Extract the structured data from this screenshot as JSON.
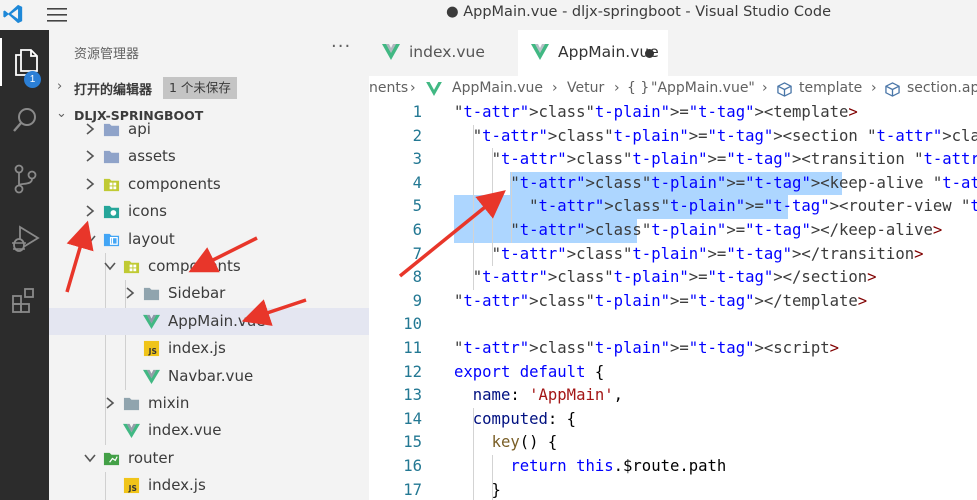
{
  "window": {
    "title": "● AppMain.vue - dljx-springboot - Visual Studio Code"
  },
  "activity_bar": {
    "items": [
      {
        "icon": "files-icon",
        "active": true,
        "badge": "1"
      },
      {
        "icon": "search-icon"
      },
      {
        "icon": "source-control-icon"
      },
      {
        "icon": "run-debug-icon"
      },
      {
        "icon": "extensions-icon"
      }
    ]
  },
  "sidebar": {
    "title": "资源管理器",
    "more": "···",
    "open_editors": {
      "label": "打开的编辑器",
      "unsaved": "1 个未保存"
    },
    "project": "DLJX-SPRINGBOOT",
    "tree": [
      {
        "name": "api",
        "kind": "folder",
        "depth": 1,
        "expanded": false
      },
      {
        "name": "assets",
        "kind": "folder",
        "depth": 1,
        "expanded": false
      },
      {
        "name": "components",
        "kind": "folder-components",
        "depth": 1,
        "expanded": false
      },
      {
        "name": "icons",
        "kind": "folder-icons",
        "depth": 1,
        "expanded": false
      },
      {
        "name": "layout",
        "kind": "folder-layout",
        "depth": 1,
        "expanded": true
      },
      {
        "name": "components",
        "kind": "folder-components",
        "depth": 2,
        "expanded": true
      },
      {
        "name": "Sidebar",
        "kind": "folder-plain",
        "depth": 3,
        "expanded": false
      },
      {
        "name": "AppMain.vue",
        "kind": "vue",
        "depth": 3,
        "selected": true
      },
      {
        "name": "index.js",
        "kind": "js",
        "depth": 3
      },
      {
        "name": "Navbar.vue",
        "kind": "vue",
        "depth": 3
      },
      {
        "name": "mixin",
        "kind": "folder-plain",
        "depth": 2,
        "expanded": false
      },
      {
        "name": "index.vue",
        "kind": "vue",
        "depth": 2
      },
      {
        "name": "router",
        "kind": "folder-router",
        "depth": 1,
        "expanded": true
      },
      {
        "name": "index.js",
        "kind": "js",
        "depth": 2
      }
    ]
  },
  "editor": {
    "tabs": [
      {
        "label": "index.vue",
        "active": false
      },
      {
        "label": "AppMain.vue",
        "active": true,
        "dirty": true
      }
    ],
    "breadcrumb": [
      "nents",
      "AppMain.vue",
      "Vetur",
      "\"AppMain.vue\"",
      "template",
      "section.ap"
    ],
    "lines": [
      {
        "n": "1",
        "text": "<template>"
      },
      {
        "n": "2",
        "text": "  <section class=\"app-main\">"
      },
      {
        "n": "3",
        "text": "    <transition name=\"fade-transform\" mode=\"out-in\">"
      },
      {
        "n": "4",
        "text": "      <keep-alive :include=\"cachedViews\">"
      },
      {
        "n": "5",
        "text": "        <router-view :key=\"key\" />"
      },
      {
        "n": "6",
        "text": "      </keep-alive>"
      },
      {
        "n": "7",
        "text": "    </transition>"
      },
      {
        "n": "8",
        "text": "  </section>"
      },
      {
        "n": "9",
        "text": "</template>"
      },
      {
        "n": "10",
        "text": ""
      },
      {
        "n": "11",
        "text": "<script>"
      },
      {
        "n": "12",
        "text": "export default {"
      },
      {
        "n": "13",
        "text": "  name: 'AppMain',"
      },
      {
        "n": "14",
        "text": "  computed: {"
      },
      {
        "n": "15",
        "text": "    key() {"
      },
      {
        "n": "16",
        "text": "      return this.$route.path"
      },
      {
        "n": "17",
        "text": "    }"
      }
    ]
  },
  "colors": {
    "activity_bar": "#2c2c2c",
    "sidebar_bg": "#f3f3f3",
    "selection": "#add6ff",
    "annotation_arrow": "#e8362a",
    "vue_icon": "#41b883",
    "js_icon": "#f0c419"
  }
}
